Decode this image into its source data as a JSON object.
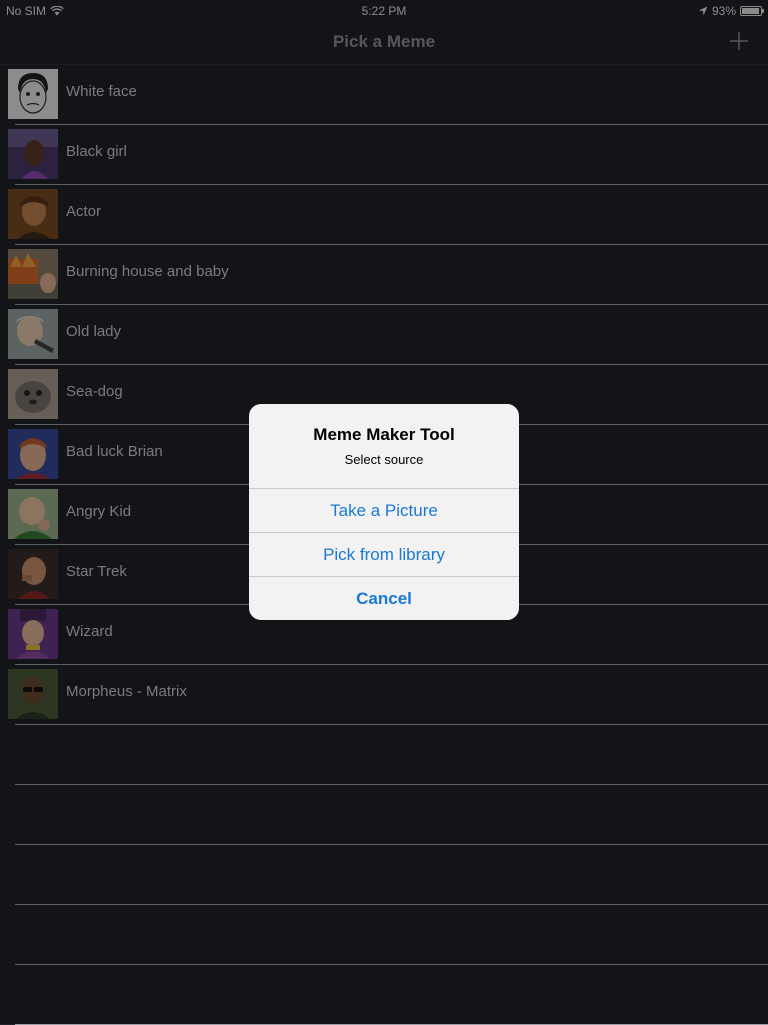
{
  "status_bar": {
    "carrier": "No SIM",
    "time": "5:22 PM",
    "battery": "93%",
    "battery_level": 0.93
  },
  "nav": {
    "title": "Pick a Meme",
    "add_icon": "plus-icon"
  },
  "memes": [
    {
      "label": "White face"
    },
    {
      "label": "Black girl"
    },
    {
      "label": "Actor"
    },
    {
      "label": "Burning house and baby"
    },
    {
      "label": "Old lady"
    },
    {
      "label": "Sea-dog"
    },
    {
      "label": "Bad luck Brian"
    },
    {
      "label": "Angry Kid"
    },
    {
      "label": "Star Trek"
    },
    {
      "label": "Wizard"
    },
    {
      "label": "Morpheus - Matrix"
    }
  ],
  "alert": {
    "title": "Meme Maker Tool",
    "message": "Select source",
    "buttons": {
      "take_picture": "Take a Picture",
      "pick_library": "Pick from library",
      "cancel": "Cancel"
    }
  },
  "colors": {
    "background": "#1f2229",
    "accent": "#1a78d6",
    "alert_bg": "#f2f2f2"
  }
}
